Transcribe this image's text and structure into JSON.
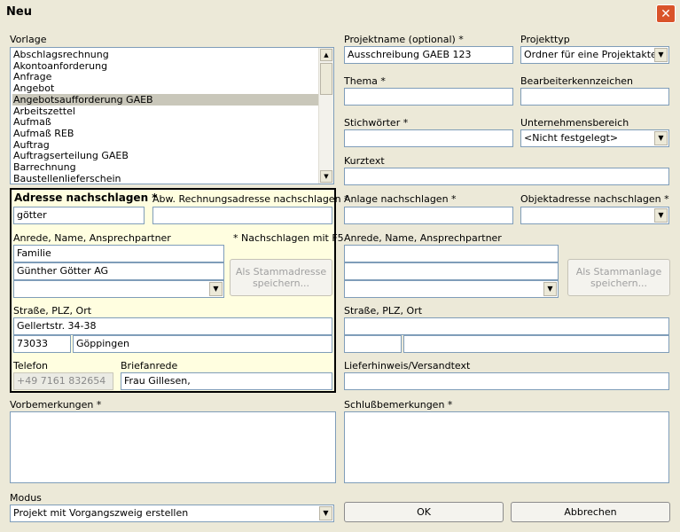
{
  "window": {
    "title": "Neu",
    "close_glyph": "✕"
  },
  "vorlage": {
    "label": "Vorlage",
    "items": [
      "Abschlagsrechnung",
      "Akontoanforderung",
      "Anfrage",
      "Angebot",
      "Angebotsaufforderung GAEB",
      "Arbeitszettel",
      "Aufmaß",
      "Aufmaß REB",
      "Auftrag",
      "Auftragserteilung GAEB",
      "Barrechnung",
      "Baustellenlieferschein"
    ],
    "selected_index": 4
  },
  "adresse": {
    "label": "Adresse nachschlagen *",
    "value": "götter",
    "abw_label": "Abw. Rechnungsadresse nachschlagen *",
    "abw_value": "",
    "note": "* Nachschlagen mit F5",
    "anrede_label": "Anrede, Name, Ansprechpartner",
    "anrede": "Familie",
    "name": "Günther Götter AG",
    "ansprechpartner": "",
    "stamm_button": "Als Stammadresse speichern...",
    "strasse_label": "Straße, PLZ, Ort",
    "strasse": "Gellertstr. 34-38",
    "plz": "73033",
    "ort": "Göppingen",
    "telefon_label": "Telefon",
    "telefon": "+49 7161 832654",
    "briefanrede_label": "Briefanrede",
    "briefanrede": "Frau Gillesen,"
  },
  "projekt": {
    "name_label": "Projektname (optional) *",
    "name_value": "Ausschreibung GAEB 123",
    "typ_label": "Projekttyp",
    "typ_value": "Ordner für eine Projektakte",
    "thema_label": "Thema *",
    "thema_value": "",
    "bearbeiter_label": "Bearbeiterkennzeichen",
    "bearbeiter_value": "",
    "stichwoerter_label": "Stichwörter *",
    "stichwoerter_value": "",
    "bereich_label": "Unternehmensbereich",
    "bereich_value": "<Nicht festgelegt>",
    "kurztext_label": "Kurztext",
    "kurztext_value": ""
  },
  "anlage": {
    "label": "Anlage nachschlagen *",
    "value": "",
    "objekt_label": "Objektadresse nachschlagen *",
    "objekt_value": "",
    "anrede_label": "Anrede, Name, Ansprechpartner",
    "stamm_button": "Als Stammanlage speichern...",
    "strasse_label": "Straße, PLZ, Ort",
    "lieferhinweis_label": "Lieferhinweis/Versandtext"
  },
  "vorbemerkungen_label": "Vorbemerkungen *",
  "schluss_label": "Schlußbemerkungen *",
  "modus": {
    "label": "Modus",
    "value": "Projekt mit Vorgangszweig erstellen"
  },
  "buttons": {
    "ok": "OK",
    "cancel": "Abbrechen"
  },
  "icons": {
    "dropdown": "chevron-down-icon",
    "close": "close-icon",
    "scroll_up": "arrow-up-icon",
    "scroll_down": "arrow-down-icon"
  }
}
